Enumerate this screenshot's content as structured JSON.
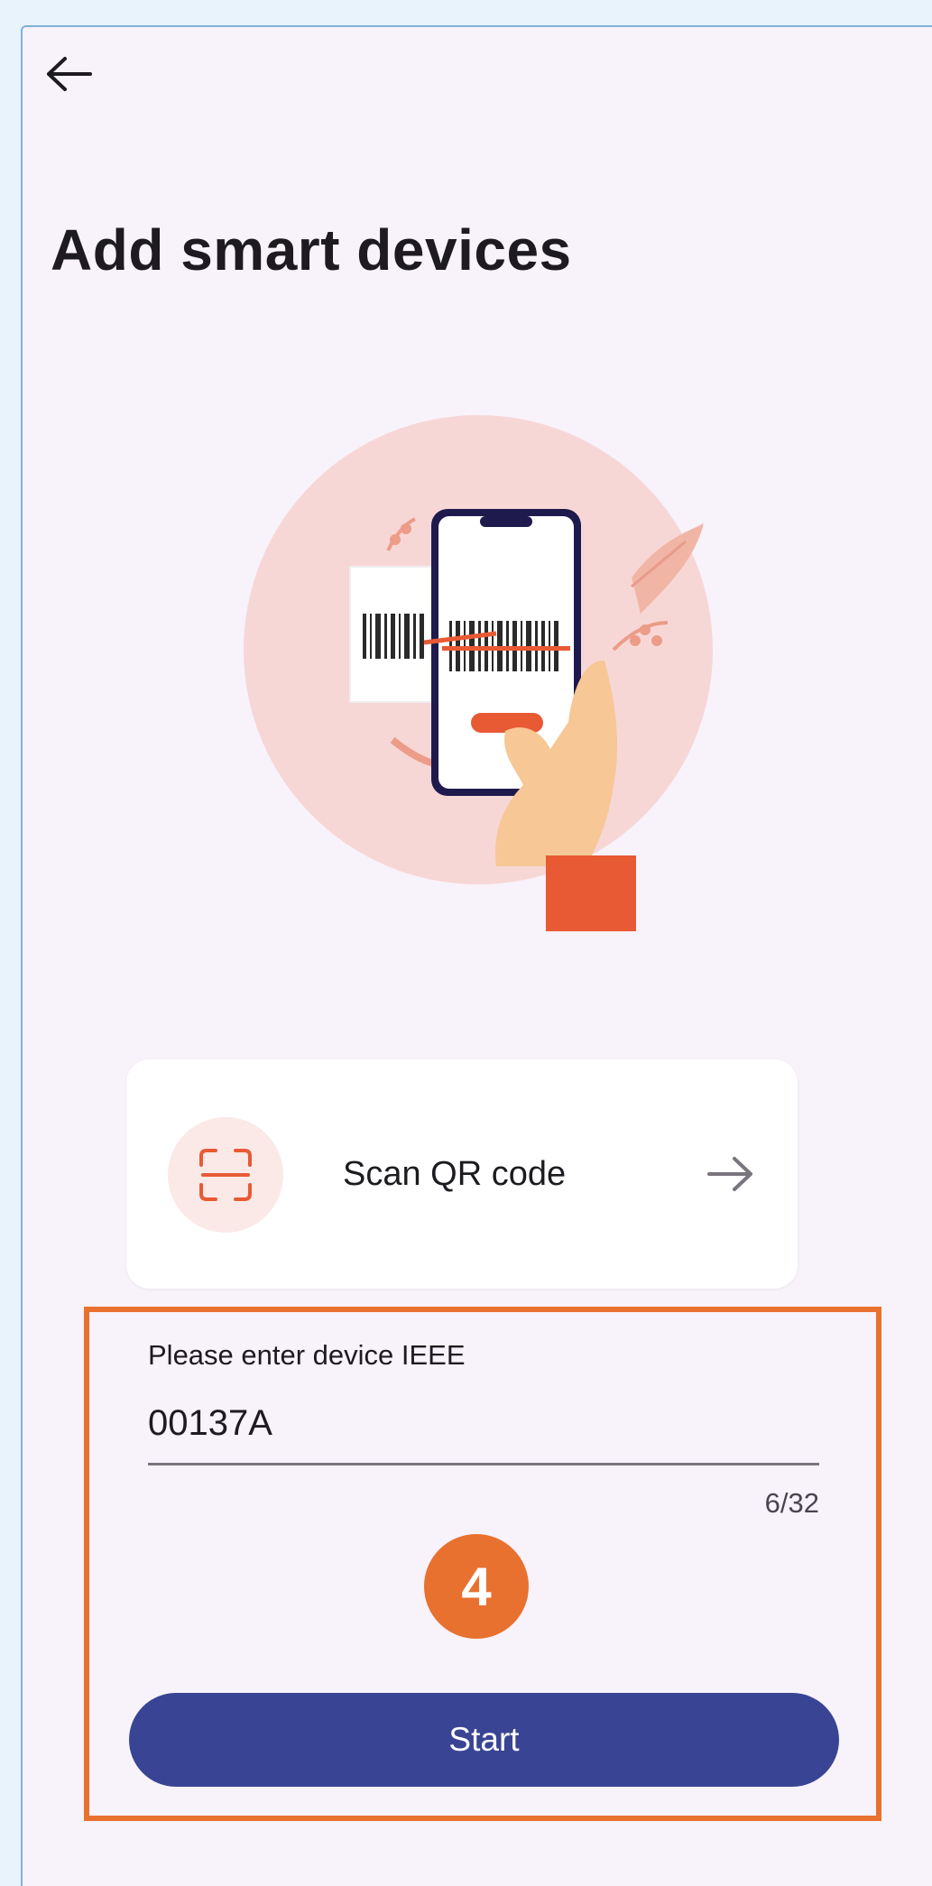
{
  "header": {
    "back_icon": "arrow-left-icon",
    "title": "Add smart devices"
  },
  "illustration": {
    "subject": "phone-scanning-barcode-illustration"
  },
  "scan_option": {
    "icon": "qr-scan-icon",
    "label": "Scan QR code",
    "arrow_icon": "arrow-right-icon"
  },
  "ieee_field": {
    "label": "Please enter device IEEE",
    "value": "00137A",
    "counter": "6/32"
  },
  "step_badge": {
    "number": "4"
  },
  "start_button": {
    "label": "Start"
  },
  "colors": {
    "highlight": "#e8712f",
    "primary": "#3a4494",
    "background": "#f8f2fa"
  }
}
